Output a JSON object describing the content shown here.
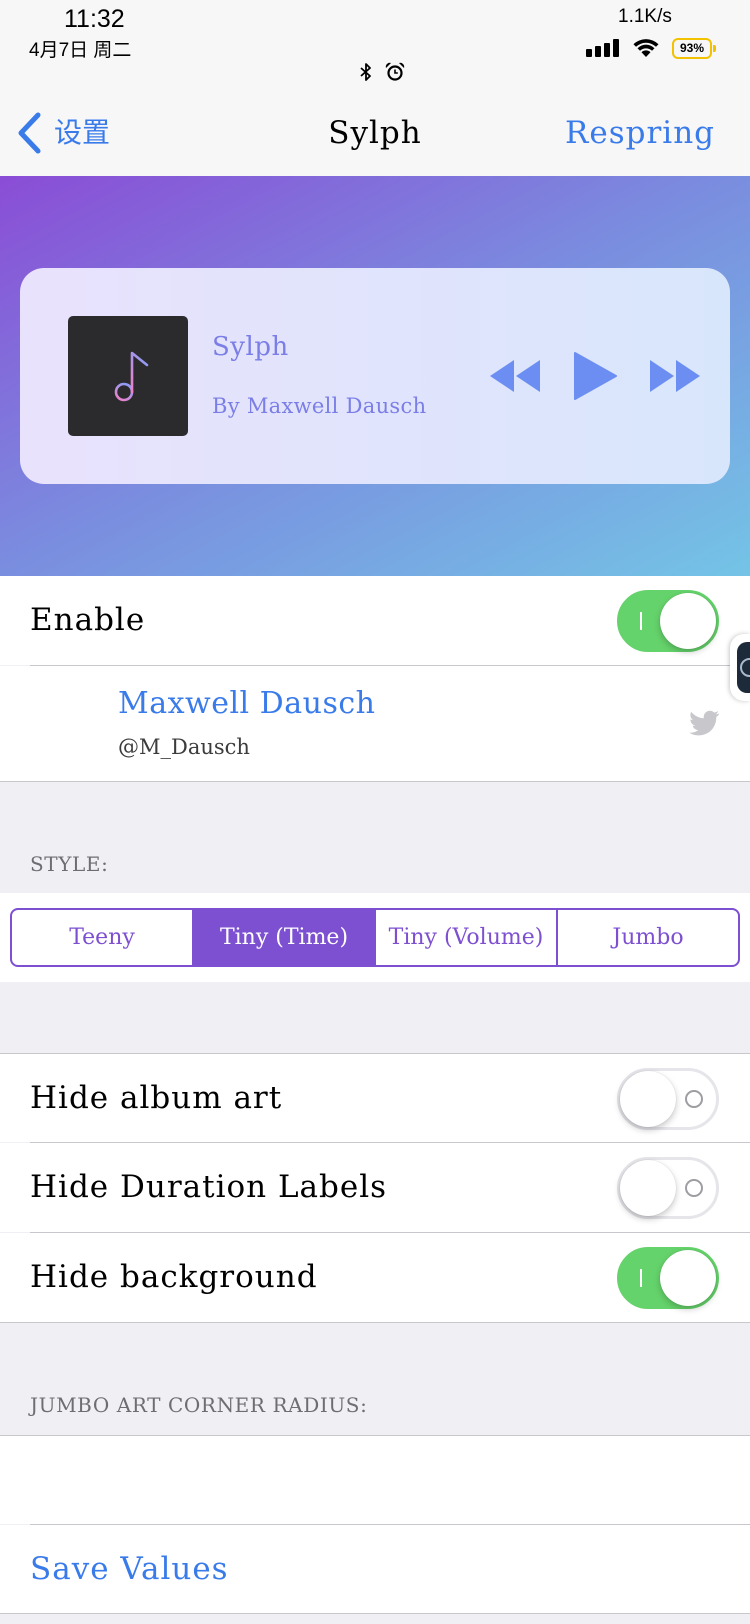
{
  "status_bar": {
    "time": "11:32",
    "date": "4月7日 周二",
    "network_speed": "1.1K/s",
    "battery_percent": "93%",
    "icons": [
      "signal-icon",
      "wifi-icon",
      "battery-icon",
      "bluetooth-icon",
      "alarm-icon"
    ]
  },
  "nav": {
    "back_label": "设置",
    "title": "Sylph",
    "action_label": "Respring"
  },
  "preview": {
    "song_title": "Sylph",
    "artist": "By Maxwell Dausch",
    "artwork_icon": "music-note-icon",
    "controls": [
      "rewind-icon",
      "play-icon",
      "fast-forward-icon"
    ]
  },
  "enable": {
    "label": "Enable",
    "on": true
  },
  "author": {
    "name": "Maxwell Dausch",
    "handle": "@M_Dausch",
    "icon": "twitter-icon"
  },
  "style": {
    "header": "STYLE:",
    "segments": [
      "Teeny",
      "Tiny (Time)",
      "Tiny (Volume)",
      "Jumbo"
    ],
    "selected_index": 1
  },
  "options": [
    {
      "label": "Hide album art",
      "on": false
    },
    {
      "label": "Hide Duration Labels",
      "on": false
    },
    {
      "label": "Hide background",
      "on": true
    }
  ],
  "corner_radius": {
    "header": "JUMBO ART CORNER RADIUS:"
  },
  "save_label": "Save Values",
  "colors": {
    "accent_blue": "#3a7bea",
    "toggle_on_green": "#65d36b",
    "segment_purple": "#7d4fd1",
    "header_gradient_start": "#8a4dd6",
    "header_gradient_mid": "#7a8edf",
    "header_gradient_end": "#74c4e6",
    "player_text": "#7a7ee6",
    "player_controls": "#6c8ef3",
    "battery_outline": "#f2c200",
    "section_header_gray": "#6d6d72",
    "grouped_background": "#efeff4"
  }
}
